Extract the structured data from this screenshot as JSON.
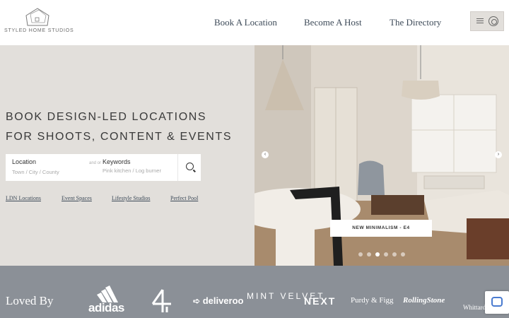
{
  "header": {
    "logo_text": "STYLED HOME STUDIOS",
    "nav": [
      "Book A Location",
      "Become A Host",
      "The Directory"
    ]
  },
  "hero": {
    "title_line1": "BOOK DESIGN-LED LOCATIONS",
    "title_line2": "FOR SHOOTS, CONTENT & EVENTS",
    "search": {
      "location_label": "Location",
      "location_placeholder": "Town / City / County",
      "and_or": "and or",
      "keywords_label": "Keywords",
      "keywords_placeholder": "Pink kitchen / Log burner"
    },
    "quick_links": [
      "LDN Locations",
      "Event Spaces",
      "Lifestyle Studios",
      "Perfect Pool"
    ],
    "slide_caption": "NEW MINIMALISM - E4",
    "slide_count": 6,
    "active_slide": 3
  },
  "brands": {
    "heading": "Loved By",
    "names": [
      "adidas",
      "Channel 4",
      "deliveroo",
      "MINT VELVET",
      "NEXT",
      "Purdy & Figg",
      "RollingStone",
      "Whittard"
    ]
  },
  "colors": {
    "hero_bg": "#e2dfdb",
    "brand_band": "#8b9097",
    "nav_text": "#3d4a58"
  }
}
